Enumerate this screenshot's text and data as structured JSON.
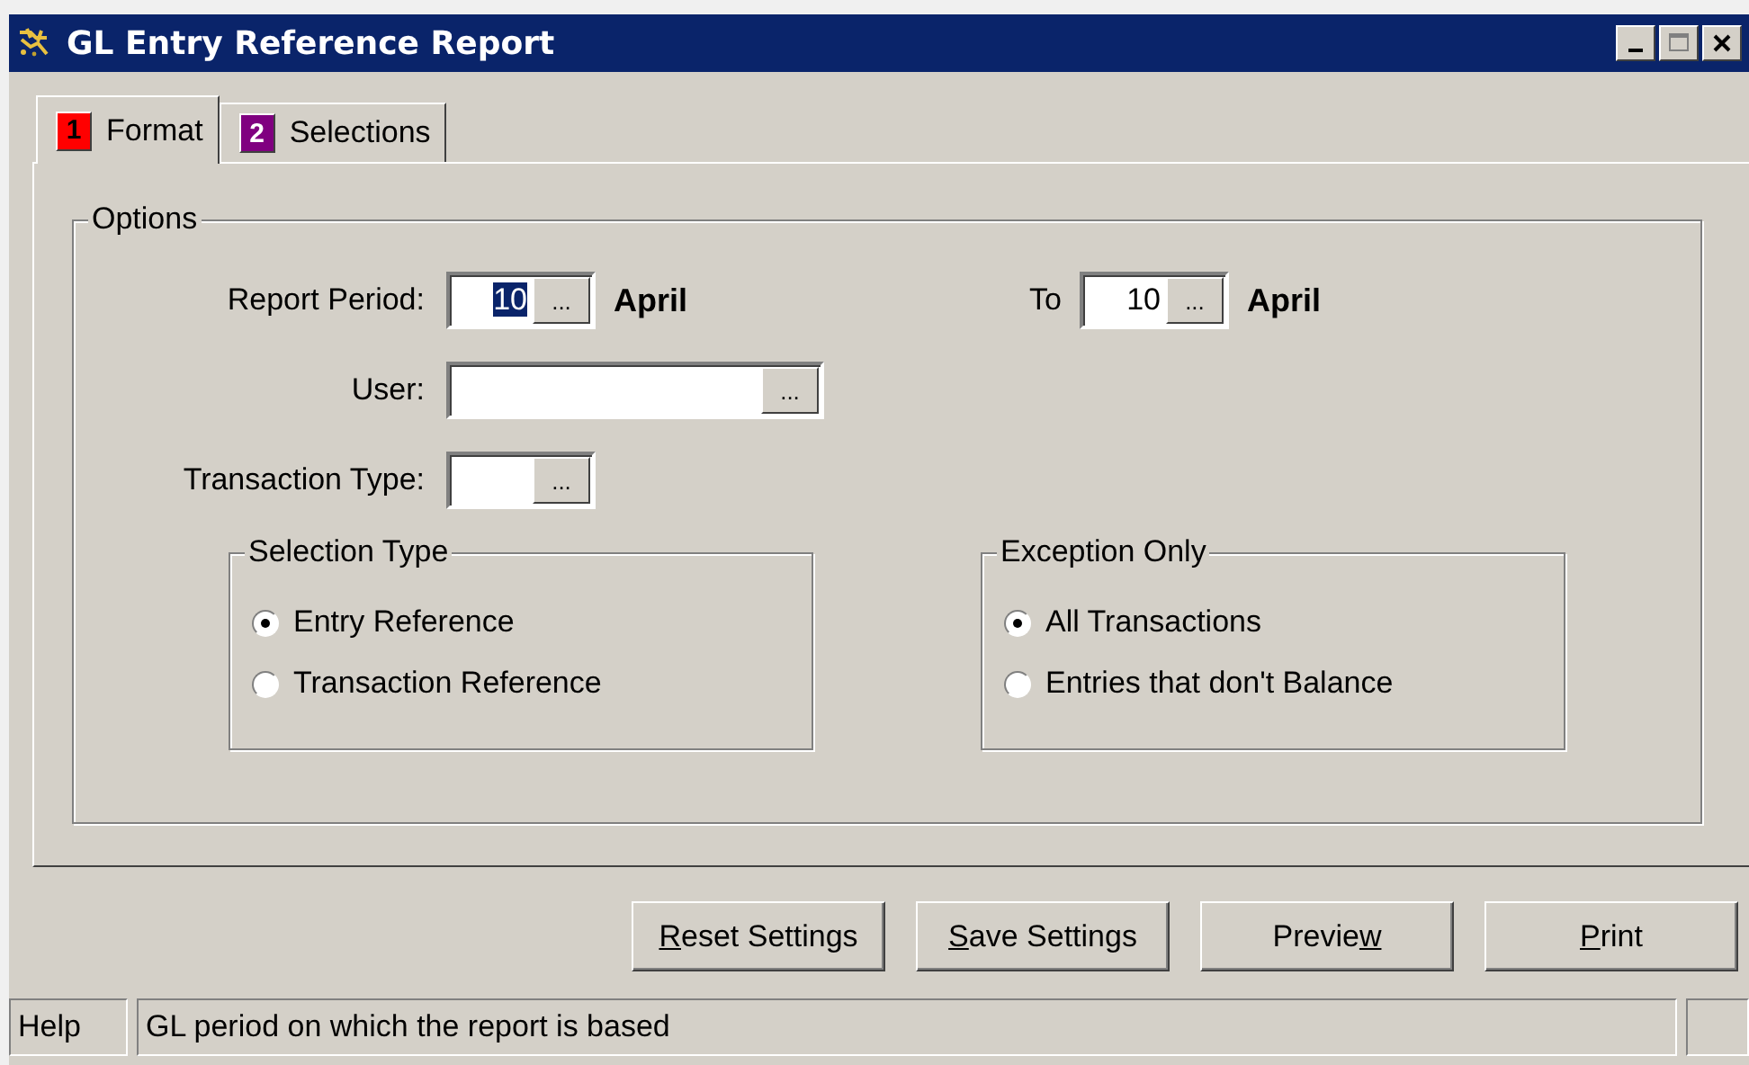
{
  "window": {
    "title": "GL Entry Reference Report"
  },
  "tabs": [
    {
      "number": "1",
      "label": "Format",
      "color": "#ff0000",
      "selected": true
    },
    {
      "number": "2",
      "label": "Selections",
      "color": "#800080",
      "selected": false
    }
  ],
  "options": {
    "title": "Options",
    "report_period": {
      "label": "Report Period:",
      "value": "10",
      "value_selected": true,
      "month": "April"
    },
    "to": {
      "label": "To",
      "value": "10",
      "value_selected": false,
      "month": "April"
    },
    "user": {
      "label": "User:"
    },
    "transaction_type": {
      "label": "Transaction Type:"
    },
    "browse_label": "...",
    "groups": [
      {
        "title": "Selection Type",
        "options": [
          {
            "label": "Entry Reference",
            "selected": true
          },
          {
            "label": "Transaction Reference",
            "selected": false
          }
        ]
      },
      {
        "title": "Exception Only",
        "options": [
          {
            "label": "All Transactions",
            "selected": true
          },
          {
            "label": "Entries that don't Balance",
            "selected": false
          }
        ]
      }
    ]
  },
  "buttons": [
    {
      "key": "R",
      "after": "eset Settings"
    },
    {
      "key": "S",
      "after": "ave Settings"
    },
    {
      "before": "Previe",
      "key": "w"
    },
    {
      "key": "P",
      "after": "rint"
    }
  ],
  "status_bar": {
    "help": "Help",
    "message": "GL period on which the report is based"
  }
}
